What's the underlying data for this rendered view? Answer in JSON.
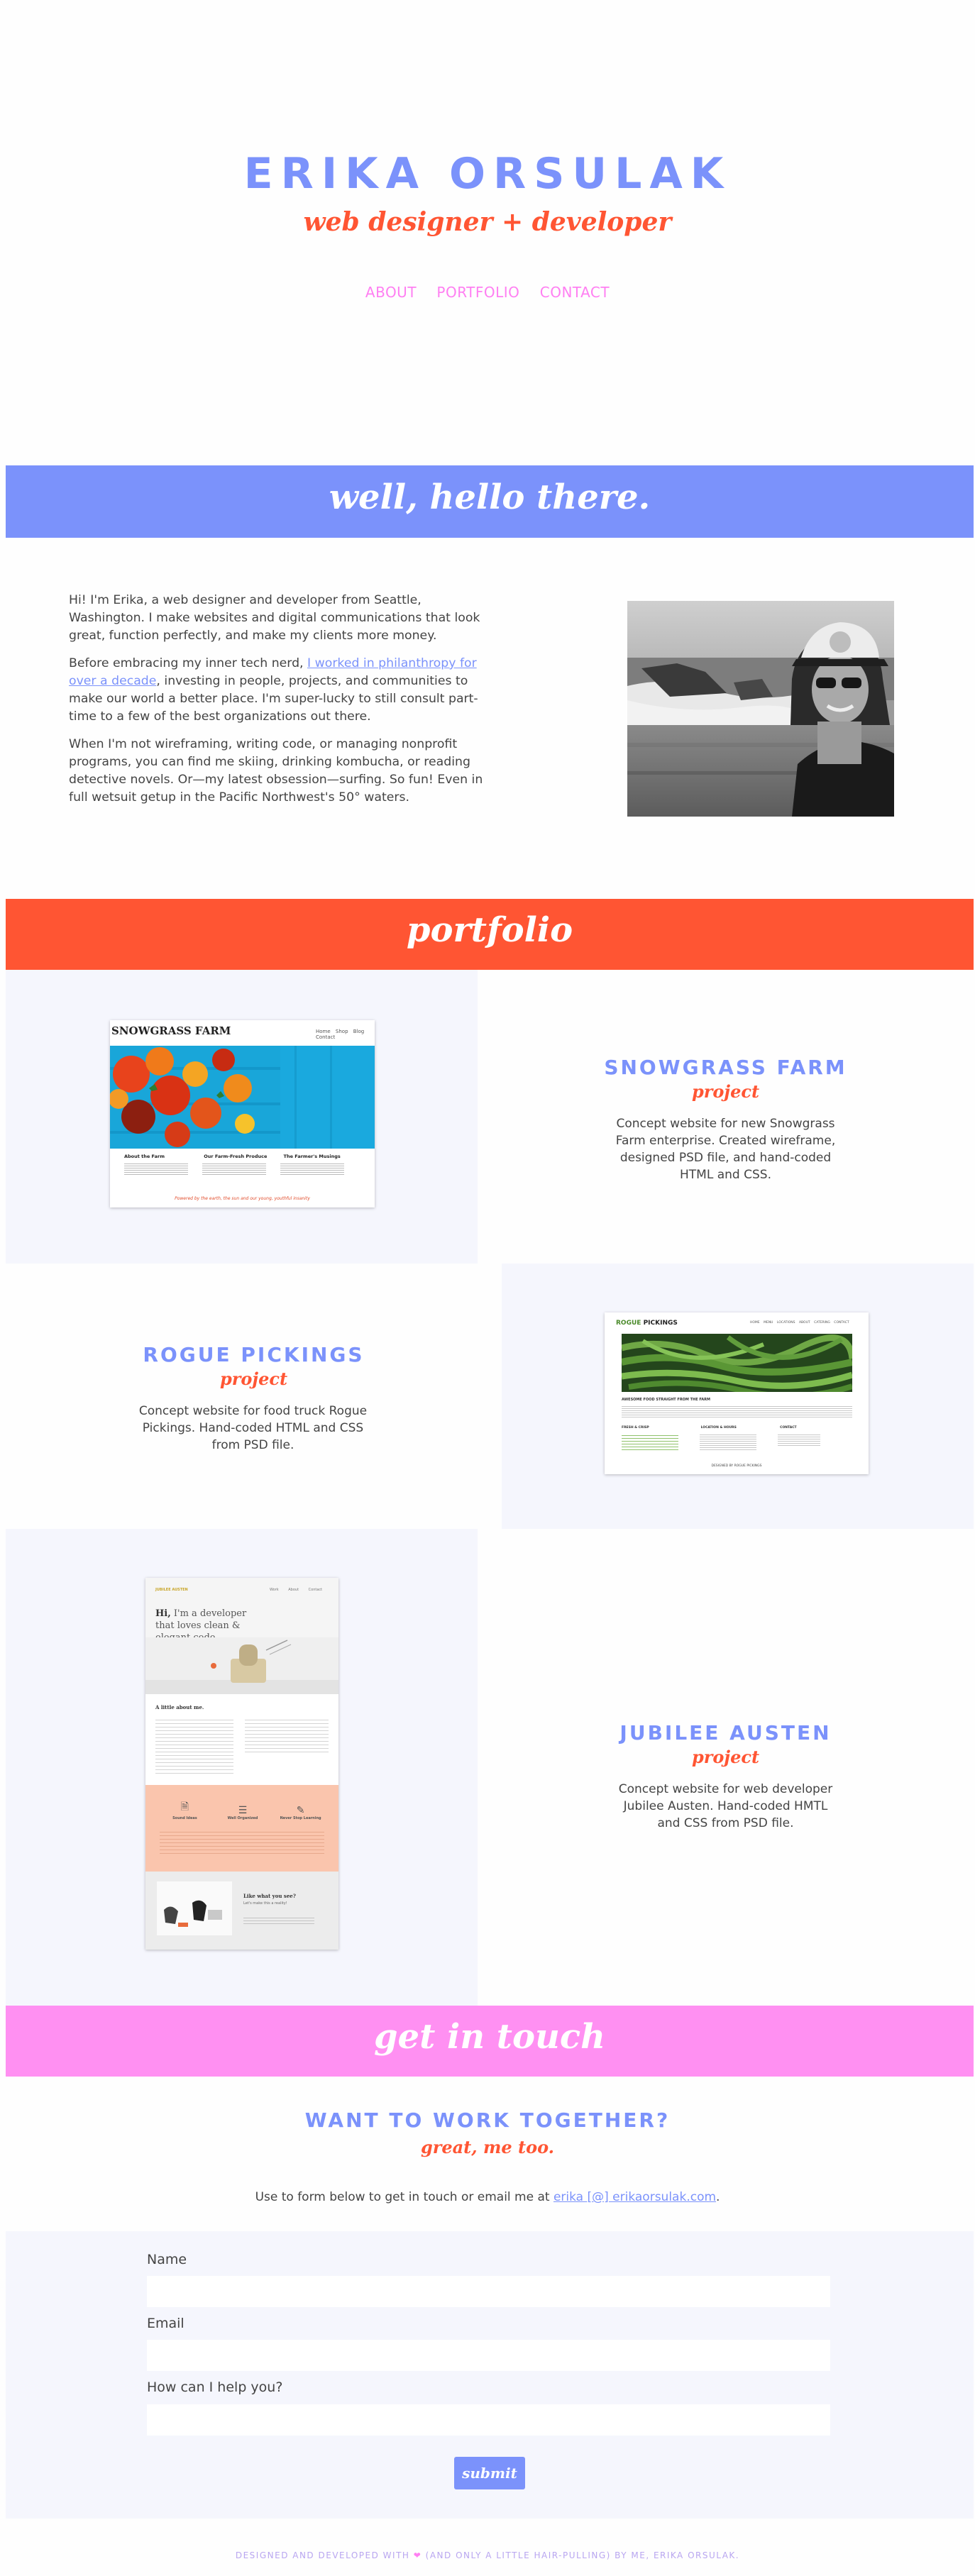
{
  "header": {
    "name": "ERIKA ORSULAK",
    "tagline": "web designer + developer",
    "nav": [
      "ABOUT",
      "PORTFOLIO",
      "CONTACT"
    ]
  },
  "about": {
    "banner": "well, hello there.",
    "p1": "Hi! I'm Erika, a web designer and developer from Seattle, Washington. I make websites and digital communications that look great, function perfectly, and make my clients more money.",
    "p2_before": "Before embracing my inner tech nerd, ",
    "p2_link": "I worked in philanthropy for over a decade",
    "p2_after": ", investing in people, projects, and communities to make our world a better place. I'm super-lucky to still consult part-time to a few of the best organizations out there.",
    "p3": "When I'm not wireframing, writing code, or managing nonprofit programs, you can find me skiing, drinking kombucha, or reading detective novels. Or—my latest obsession—surfing. So fun! Even in full wetsuit getup in the Pacific Northwest's 50° waters."
  },
  "portfolio": {
    "banner": "portfolio",
    "projects": [
      {
        "title": "SNOWGRASS FARM",
        "sub": "project",
        "desc": "Concept website for new Snowgrass Farm enterprise. Created wireframe, designed PSD file, and hand-coded HTML and CSS.",
        "shot": {
          "brand": "SNOWGRASS FARM",
          "nav": [
            "Home",
            "Shop",
            "Blog",
            "Contact"
          ],
          "cols": [
            "About the Farm",
            "Our Farm-Fresh Produce",
            "The Farmer's Musings"
          ],
          "footer": "Powered by the earth, the sun and our young, youthful insanity"
        }
      },
      {
        "title": "ROGUE PICKINGS",
        "sub": "project",
        "desc": "Concept website for food truck Rogue Pickings. Hand-coded HTML and CSS from PSD file.",
        "shot": {
          "brand_a": "ROGUE",
          "brand_b": "PICKINGS",
          "nav": [
            "HOME",
            "MENU",
            "LOCATIONS",
            "ABOUT",
            "CATERING",
            "CONTACT"
          ],
          "heading": "AWESOME FOOD STRAIGHT FROM THE FARM",
          "cols": [
            "FRESH & CRISP",
            "LOCATION & HOURS",
            "CONTACT"
          ],
          "footer": "DESIGNED BY ROGUE PICKINGS"
        }
      },
      {
        "title": "JUBILEE AUSTEN",
        "sub": "project",
        "desc": "Concept website for web developer Jubilee Austen. Hand-coded HMTL and CSS from PSD file.",
        "shot": {
          "brand": "JUBILEE AUSTEN",
          "nav": [
            "Work",
            "About",
            "Contact"
          ],
          "hero_hi": "Hi,",
          "hero_rest": "I'm a developer that loves clean & elegant code.",
          "about_head": "A little about me.",
          "services": [
            "Sound Ideas",
            "Well Organized",
            "Never Stop Learning"
          ],
          "like": "Like what you see?",
          "cta": "Let's make this a reality!"
        }
      }
    ]
  },
  "contact": {
    "banner": "get in touch",
    "heading": "WANT TO WORK TOGETHER?",
    "sub": "great, me too.",
    "intro_before": "Use to form below to get in touch or email me at ",
    "email": "erika [@] erikaorsulak.com",
    "intro_after": ".",
    "fields": [
      "Name",
      "Email",
      "How can I help you?"
    ],
    "submit": "submit"
  },
  "footer": {
    "before": "DESIGNED AND DEVELOPED WITH ",
    "heart": "❤",
    "after": " (AND ONLY A LITTLE HAIR-PULLING) BY ME, ERIKA ORSULAK."
  },
  "colors": {
    "blue": "#7b92fb",
    "orange": "#ff5533",
    "pink": "#ff90f2",
    "tint": "#f5f6fd"
  }
}
